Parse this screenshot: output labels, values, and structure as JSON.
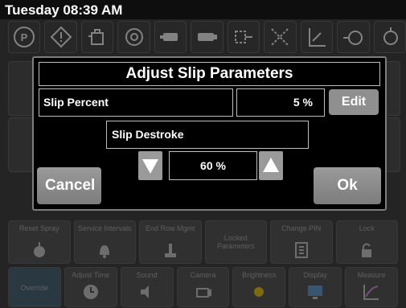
{
  "status": {
    "time": "Tuesday 08:39 AM"
  },
  "toolbar_icons": [
    "parking-icon",
    "warning-icon",
    "engine-oil-icon",
    "turbo-icon",
    "camera-icon",
    "camera-alt-icon",
    "hydraulic-icon",
    "filter-icon",
    "lift-icon",
    "transmission-icon",
    "engine-icon"
  ],
  "background_tiles": {
    "row1": [
      {
        "label": "Reset Spray",
        "icon": "spray-icon"
      },
      {
        "label": "Service Intervals",
        "icon": "bell-icon"
      },
      {
        "label": "End Row Mgmt",
        "icon": "joystick-icon"
      },
      {
        "label": "Locked Parameters",
        "icon": "none"
      },
      {
        "label": "Change PIN",
        "icon": "keypad-icon"
      },
      {
        "label": "Lock",
        "icon": "lock-icon"
      }
    ],
    "row2": [
      {
        "label": "Override",
        "icon": "none"
      },
      {
        "label": "Adjust Time",
        "icon": "clock-icon"
      },
      {
        "label": "Sound",
        "icon": "speaker-icon"
      },
      {
        "label": "Camera",
        "icon": "camera-icon"
      },
      {
        "label": "Brightness",
        "icon": "sun-icon"
      },
      {
        "label": "Display",
        "icon": "display-icon"
      },
      {
        "label": "Measure",
        "icon": "graph-icon"
      }
    ]
  },
  "dialog": {
    "title": "Adjust Slip Parameters",
    "slip_percent_label": "Slip Percent",
    "slip_percent_value": "5 %",
    "edit_label": "Edit",
    "slip_destroke_label": "Slip Destroke",
    "slip_destroke_value": "60 %",
    "cancel_label": "Cancel",
    "ok_label": "Ok"
  }
}
